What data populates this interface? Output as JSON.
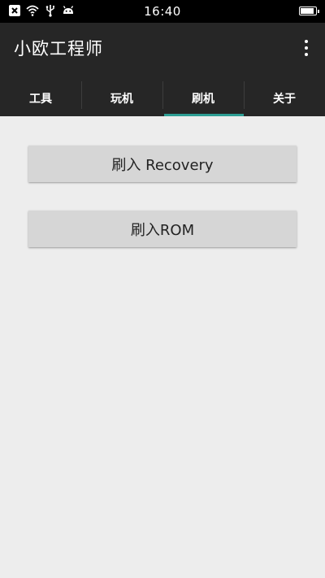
{
  "status_bar": {
    "time": "16:40",
    "icons": [
      "close-box-icon",
      "wifi-icon",
      "usb-icon",
      "android-icon"
    ],
    "battery_level": 0.95
  },
  "app": {
    "title": "小欧工程师",
    "menu_icon": "more-vert-icon"
  },
  "tabs": [
    {
      "label": "工具"
    },
    {
      "label": "玩机"
    },
    {
      "label": "刷机",
      "selected": true
    },
    {
      "label": "关于"
    }
  ],
  "colors": {
    "tab_indicator": "#2e9e93",
    "app_bar": "#262626",
    "content_bg": "#ededed",
    "button_bg": "#d6d6d6"
  },
  "actions": {
    "flash_recovery_label": "刷入 Recovery",
    "flash_rom_label": "刷入ROM"
  }
}
